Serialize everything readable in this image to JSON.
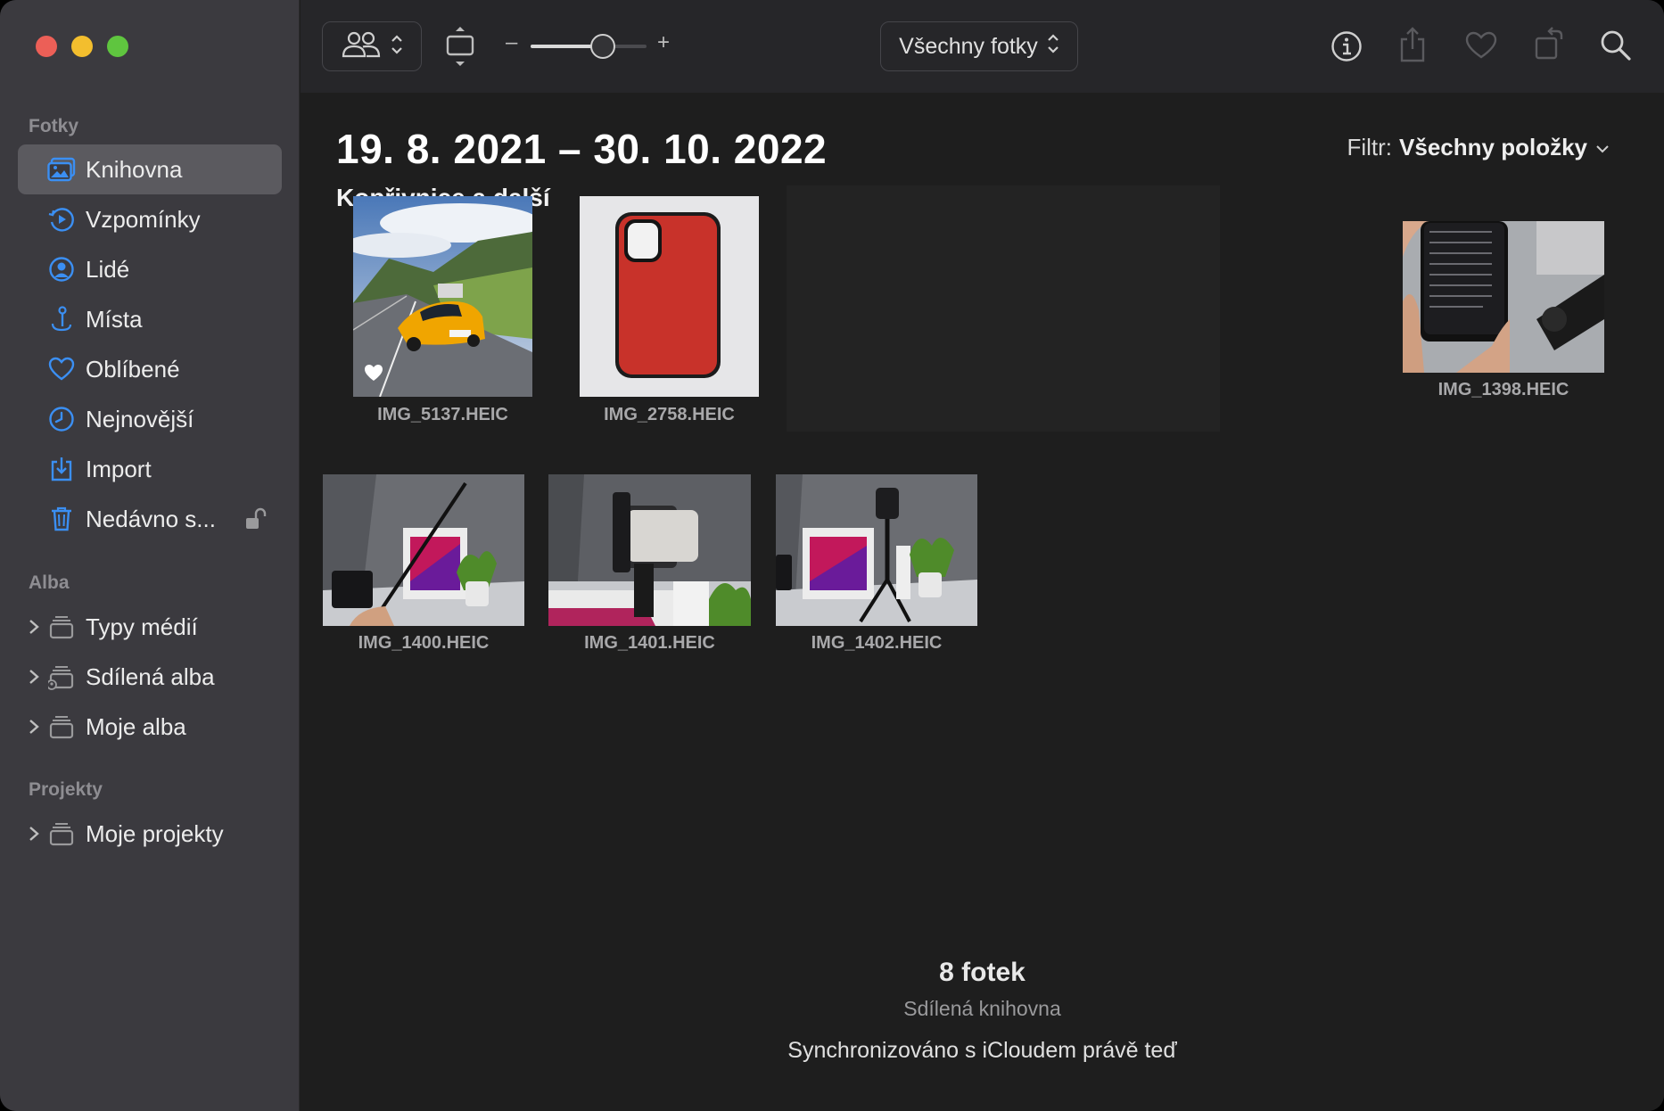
{
  "sidebar": {
    "sections": {
      "photos": "Fotky",
      "albums": "Alba",
      "projects": "Projekty"
    },
    "items": [
      {
        "label": "Knihovna",
        "icon": "library-icon",
        "active": true
      },
      {
        "label": "Vzpomínky",
        "icon": "memories-icon"
      },
      {
        "label": "Lidé",
        "icon": "people-icon"
      },
      {
        "label": "Místa",
        "icon": "places-icon"
      },
      {
        "label": "Oblíbené",
        "icon": "heart-icon"
      },
      {
        "label": "Nejnovější",
        "icon": "clock-icon"
      },
      {
        "label": "Import",
        "icon": "import-icon"
      },
      {
        "label": "Nedávno s...",
        "icon": "trash-icon"
      }
    ],
    "album_groups": [
      {
        "label": "Typy médií",
        "icon": "album-stack-icon"
      },
      {
        "label": "Sdílená alba",
        "icon": "shared-album-icon"
      },
      {
        "label": "Moje alba",
        "icon": "album-stack-icon"
      }
    ],
    "project_groups": [
      {
        "label": "Moje projekty",
        "icon": "album-stack-icon"
      }
    ]
  },
  "toolbar": {
    "zoom_minus": "–",
    "zoom_plus": "+",
    "zoom_level": 0.62,
    "view_select": "Všechny fotky"
  },
  "main": {
    "date_range": "19. 8. 2021 – 30. 10. 2022",
    "location": "Kopřivnice a další",
    "filter_label": "Filtr:",
    "filter_value": "Všechny položky",
    "photos": [
      {
        "name": "IMG_5137.HEIC",
        "favorite": true
      },
      {
        "name": "IMG_2758.HEIC"
      },
      {
        "name": "IMG_1398.HEIC"
      },
      {
        "name": "IMG_1400.HEIC"
      },
      {
        "name": "IMG_1401.HEIC"
      },
      {
        "name": "IMG_1402.HEIC"
      }
    ],
    "footer": {
      "count": "8 fotek",
      "library": "Sdílená knihovna",
      "sync": "Synchronizováno s iCloudem právě teď"
    }
  },
  "colors": {
    "accent": "#3b8ff3",
    "sidebar_bg": "#3b3a3f",
    "main_bg": "#1e1e1e",
    "toolbar_bg": "#262629"
  }
}
